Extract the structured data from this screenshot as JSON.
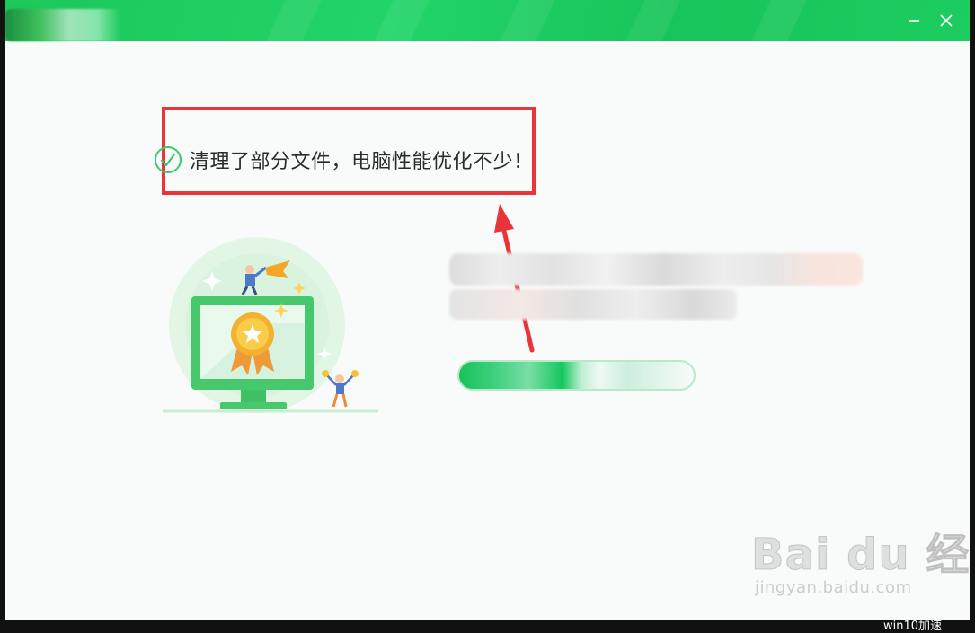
{
  "window": {
    "minimize_icon": "minimize-icon",
    "close_icon": "close-icon",
    "accent_color": "#1bc85a"
  },
  "result": {
    "status_icon": "check-circle-icon",
    "message": "清理了部分文件，电脑性能优化不少！"
  },
  "annotation": {
    "box_color": "#e9343a",
    "arrow_color": "#e9343a"
  },
  "watermark": {
    "brand": "Bai du 经验",
    "url": "jingyan.baidu.com"
  },
  "taskbar": {
    "label": "win10加速"
  }
}
